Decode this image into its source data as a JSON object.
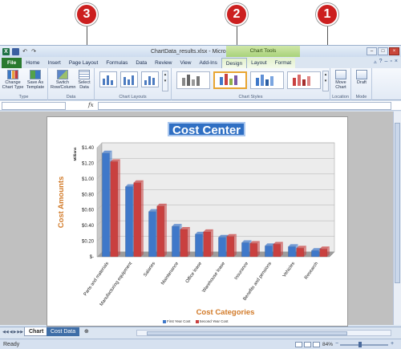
{
  "callouts": [
    {
      "label": "3"
    },
    {
      "label": "2"
    },
    {
      "label": "1"
    }
  ],
  "window": {
    "title": "ChartData_results.xlsx - Microsoft Excel",
    "contextual_tools": "Chart Tools"
  },
  "tabs": [
    {
      "label": "File"
    },
    {
      "label": "Home"
    },
    {
      "label": "Insert"
    },
    {
      "label": "Page Layout"
    },
    {
      "label": "Formulas"
    },
    {
      "label": "Data"
    },
    {
      "label": "Review"
    },
    {
      "label": "View"
    },
    {
      "label": "Add-Ins"
    },
    {
      "label": "Design"
    },
    {
      "label": "Layout"
    },
    {
      "label": "Format"
    }
  ],
  "ribbon": {
    "type_group": {
      "label": "Type",
      "change": "Change Chart Type",
      "save": "Save As Template"
    },
    "data_group": {
      "label": "Data",
      "switch": "Switch Row/Column",
      "select": "Select Data"
    },
    "layouts_group": {
      "label": "Chart Layouts"
    },
    "styles_group": {
      "label": "Chart Styles"
    },
    "location_group": {
      "label": "Location",
      "move": "Move Chart"
    },
    "mode_group": {
      "label": "Mode",
      "draft": "Draft"
    }
  },
  "formula": {
    "fx": "fx"
  },
  "sheet_tabs": [
    {
      "label": "Chart"
    },
    {
      "label": "Cost Data"
    }
  ],
  "status": {
    "ready": "Ready",
    "zoom": "84%",
    "zoom_fraction": 0.84
  },
  "chart_data": {
    "type": "bar",
    "title": "Cost Center",
    "xlabel": "Cost Categories",
    "ylabel": "Cost Amounts",
    "unit_label": "Millions",
    "categories": [
      "Parts and materials",
      "Manufacturing equipment",
      "Salaries",
      "Maintenance",
      "Office lease",
      "Warehouse lease",
      "Insurance",
      "Benefits and pensions",
      "Vehicles",
      "Research"
    ],
    "series": [
      {
        "name": "First Year Cost",
        "color": "#3f78c9",
        "values": [
          1.33,
          0.9,
          0.58,
          0.39,
          0.29,
          0.25,
          0.18,
          0.14,
          0.13,
          0.08
        ]
      },
      {
        "name": "Second Year Cost",
        "color": "#c9403f",
        "values": [
          1.22,
          0.95,
          0.65,
          0.35,
          0.32,
          0.26,
          0.17,
          0.16,
          0.11,
          0.1
        ]
      }
    ],
    "yticks": [
      "$-",
      "$0.20",
      "$0.40",
      "$0.60",
      "$0.80",
      "$1.00",
      "$1.20",
      "$1.40"
    ],
    "ylim": [
      0,
      1.4
    ],
    "grid": true,
    "legend": "bottom"
  }
}
